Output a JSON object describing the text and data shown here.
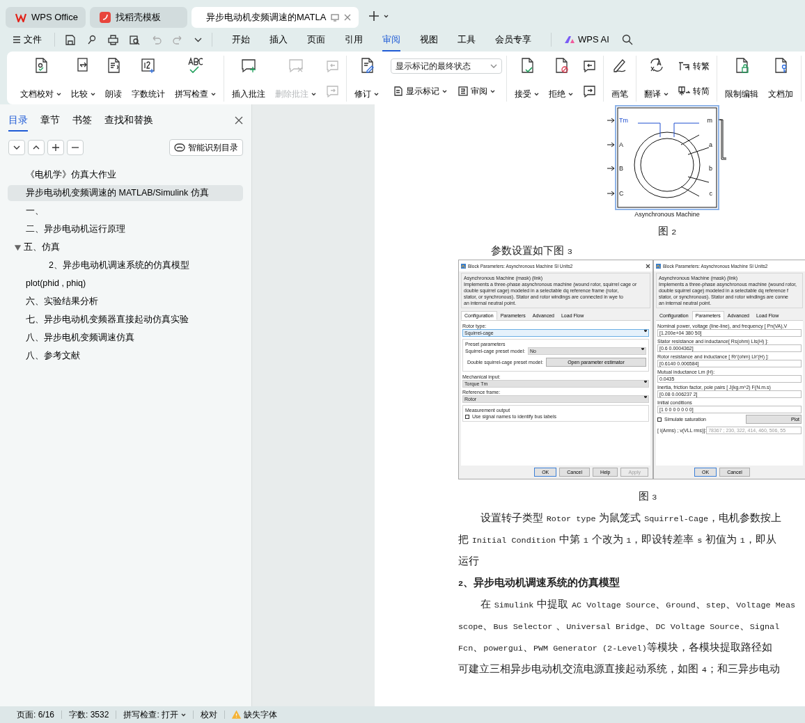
{
  "browser_tabs": [
    {
      "label": "WPS Office",
      "selected": false
    },
    {
      "label": "找稻壳模板",
      "selected": false
    },
    {
      "label": "异步电动机变频调速的MATLA",
      "selected": true
    }
  ],
  "file_menu": "文件",
  "menu_tabs": [
    {
      "label": "开始",
      "selected": false
    },
    {
      "label": "插入",
      "selected": false
    },
    {
      "label": "页面",
      "selected": false
    },
    {
      "label": "引用",
      "selected": false
    },
    {
      "label": "审阅",
      "selected": true
    },
    {
      "label": "视图",
      "selected": false
    },
    {
      "label": "工具",
      "selected": false
    },
    {
      "label": "会员专享",
      "selected": false
    }
  ],
  "ai_label": "WPS AI",
  "ribbon_groups": [
    [
      {
        "kind": "large",
        "label": "文档校对",
        "dropdown": true,
        "disabled": false
      },
      {
        "kind": "large",
        "label": "比较",
        "dropdown": true,
        "disabled": false
      },
      {
        "kind": "large",
        "label": "朗读",
        "dropdown": false,
        "disabled": false
      },
      {
        "kind": "large",
        "label": "字数统计",
        "dropdown": false,
        "disabled": false
      },
      {
        "kind": "large",
        "label": "拼写检查",
        "dropdown": true,
        "disabled": false
      }
    ],
    [
      {
        "kind": "large",
        "label": "插入批注",
        "dropdown": false,
        "disabled": false
      },
      {
        "kind": "large",
        "label": "删除批注",
        "dropdown": true,
        "disabled": true
      },
      {
        "kind": "icon_pair",
        "disabled": true
      }
    ],
    [
      {
        "kind": "large",
        "label": "修订",
        "dropdown": true,
        "disabled": false
      },
      {
        "kind": "markup_panel",
        "select": "显示标记的最终状态",
        "buttons": [
          {
            "label": "显示标记",
            "dropdown": true
          },
          {
            "label": "审阅",
            "dropdown": true
          }
        ]
      }
    ],
    [
      {
        "kind": "large",
        "label": "接受",
        "dropdown": true,
        "disabled": false
      },
      {
        "kind": "large",
        "label": "拒绝",
        "dropdown": true,
        "disabled": false
      },
      {
        "kind": "icon_pair",
        "disabled": false
      }
    ],
    [
      {
        "kind": "large",
        "label": "画笔",
        "dropdown": false,
        "disabled": false
      }
    ],
    [
      {
        "kind": "large",
        "label": "翻译",
        "dropdown": true,
        "disabled": false
      },
      {
        "kind": "small_stack",
        "buttons": [
          {
            "label": "转繁"
          },
          {
            "label": "转简"
          }
        ]
      }
    ],
    [
      {
        "kind": "large",
        "label": "限制编辑",
        "dropdown": false,
        "disabled": false
      },
      {
        "kind": "large",
        "label": "文档加",
        "dropdown": false,
        "disabled": false
      }
    ]
  ],
  "sidebar": {
    "tabs": [
      {
        "label": "目录",
        "selected": true
      },
      {
        "label": "章节",
        "selected": false
      },
      {
        "label": "书签",
        "selected": false
      },
      {
        "label": "查找和替换",
        "selected": false
      }
    ],
    "smart_button": "智能识别目录",
    "outline": [
      {
        "label": "《电机学》仿真大作业",
        "selected": false
      },
      {
        "label": "异步电动机变频调速的 MATLAB/Simulink 仿真",
        "selected": true
      },
      {
        "label": "一、",
        "selected": false
      },
      {
        "label": "二、异步电动机运行原理",
        "selected": false
      },
      {
        "label": "五、仿真",
        "selected": false,
        "expanded": true,
        "children": [
          {
            "label": "2、异步电动机调速系统的仿真模型",
            "selected": false
          }
        ]
      },
      {
        "label": "plot(phid , phiq)",
        "selected": false
      },
      {
        "label": "六、实验结果分析",
        "selected": false
      },
      {
        "label": "七、异步电动机变频器直接起动仿真实验",
        "selected": false
      },
      {
        "label": "八、异步电机变频调速仿真",
        "selected": false
      },
      {
        "label": "八、参考文献",
        "selected": false
      }
    ]
  },
  "document": {
    "figure2": {
      "ports_left": [
        "Tm",
        "A",
        "B",
        "C"
      ],
      "ports_right": [
        "m",
        "a",
        "b",
        "c"
      ],
      "block_name": "Asynchronous Machine",
      "caption": "图 2"
    },
    "intro": "参数设置如下图 3",
    "figure3": {
      "caption": "图 3",
      "dialogs": [
        {
          "title": "Block Parameters: Asynchronous Machine SI Units2",
          "closable": true,
          "mask": "Asynchronous Machine (mask) (link)",
          "description": [
            "Implements a three-phase asynchronous machine (wound rotor, squirrel cage or",
            "double squirrel cage) modeled in a selectable dq reference frame (rotor,",
            "stator, or synchronous). Stator and rotor windings are connected in wye to",
            "an internal neutral point."
          ],
          "tabs": [
            {
              "label": "Configuration",
              "selected": true
            },
            {
              "label": "Parameters",
              "selected": false
            },
            {
              "label": "Advanced",
              "selected": false
            },
            {
              "label": "Load Flow",
              "selected": false
            }
          ],
          "fields": [
            {
              "kind": "label",
              "text": "Rotor type:"
            },
            {
              "kind": "select",
              "value": "Squirrel-cage",
              "focused": true
            },
            {
              "kind": "group",
              "title": "Preset parameters",
              "items": [
                {
                  "kind": "inline_select",
                  "label": "Squirrel-cage preset model:",
                  "value": "No"
                },
                {
                  "kind": "inline_button",
                  "label": "Double squirrel-cage preset model:",
                  "button": "Open parameter estimator"
                }
              ]
            },
            {
              "kind": "label",
              "text": "Mechanical input:"
            },
            {
              "kind": "select",
              "value": "Torque Tm",
              "focused": false
            },
            {
              "kind": "label",
              "text": "Reference frame:"
            },
            {
              "kind": "select",
              "value": "Rotor",
              "focused": false
            },
            {
              "kind": "group",
              "title": "Measurement output",
              "items": [
                {
                  "kind": "checkbox",
                  "label": "Use signal names to identify bus labels",
                  "checked": false
                }
              ]
            }
          ],
          "buttons": [
            {
              "label": "OK",
              "disabled": false
            },
            {
              "label": "Cancel",
              "disabled": false
            },
            {
              "label": "Help",
              "disabled": false
            },
            {
              "label": "Apply",
              "disabled": true
            }
          ]
        },
        {
          "title": "Block Parameters: Asynchronous Machine SI Units2",
          "closable": false,
          "mask": "Asynchronous Machine (mask) (link)",
          "description": [
            "Implements a three-phase asynchronous machine (wound rotor,",
            "double squirrel cage) modeled in a selectable dq reference f",
            "stator, or synchronous). Stator and rotor windings are conne",
            "an internal neutral point."
          ],
          "tabs": [
            {
              "label": "Configuration",
              "selected": false
            },
            {
              "label": "Parameters",
              "selected": true
            },
            {
              "label": "Advanced",
              "selected": false
            },
            {
              "label": "Load Flow",
              "selected": false
            }
          ],
          "fields": [
            {
              "kind": "label",
              "text": "Nominal power, voltage (line-line), and frequency [ Pn(VA),V"
            },
            {
              "kind": "field",
              "value": "[1.200e+04 380 50]"
            },
            {
              "kind": "label",
              "text": "Stator resistance and inductance[ Rs(ohm)  Lls(H) ]:"
            },
            {
              "kind": "field",
              "value": "[0.6 0.0004362]"
            },
            {
              "kind": "label",
              "text": "Rotor resistance and inductance [ Rr'(ohm)  Llr'(H) ]:"
            },
            {
              "kind": "field",
              "value": "[0.6140 0.006584]"
            },
            {
              "kind": "label",
              "text": "Mutual inductance Lm (H):"
            },
            {
              "kind": "field",
              "value": "0.0435"
            },
            {
              "kind": "label",
              "text": "Inertia, friction factor, pole pairs [ J(kg.m^2)  F(N.m.s)"
            },
            {
              "kind": "field",
              "value": "[0.08 0.006237 2]"
            },
            {
              "kind": "label",
              "text": "Initial conditions"
            },
            {
              "kind": "field",
              "value": "[1 0 0 0 0 0 0 0]"
            },
            {
              "kind": "checkbox_button",
              "label": "Simulate saturation",
              "checked": false,
              "button": "Plot"
            },
            {
              "kind": "inline_field",
              "label": "[ i(Arms) ; v(VLL rms)]:",
              "value": "78367 ; 230, 322, 414, 460, 506, 55",
              "disabled": true
            }
          ],
          "buttons": [
            {
              "label": "OK",
              "disabled": false
            },
            {
              "label": "Cancel",
              "disabled": false
            }
          ]
        }
      ]
    },
    "paragraphs": [
      {
        "kind": "body",
        "lines": [
          "设置转子类型 Rotor type 为鼠笼式 Squirrel-Cage，电机参数按上",
          "把 Initial Condition 中第 1 个改为 1，即设转差率 s 初值为 1，即从",
          "运行"
        ]
      },
      {
        "kind": "heading",
        "lines": [
          "2、异步电动机调速系统的仿真模型"
        ]
      },
      {
        "kind": "body",
        "lines": [
          "在 Simulink 中提取 AC Voltage Source、Ground、step、Voltage Meas",
          "scope、Bus Selector 、Universal Bridge、DC Voltage Source、Signal",
          "Fcn、powergui、PWM Generator (2-Level)等模块，各模块提取路径如",
          "可建立三相异步电动机交流电源直接起动系统，如图 4；和三异步电动"
        ]
      }
    ]
  },
  "status_bar": [
    {
      "kind": "text",
      "label": "页面: 6/16",
      "dropdown": false
    },
    {
      "kind": "text",
      "label": "字数: 3532",
      "dropdown": false
    },
    {
      "kind": "text",
      "label": "拼写检查: 打开",
      "dropdown": true
    },
    {
      "kind": "text",
      "label": "校对",
      "dropdown": false
    },
    {
      "kind": "warning",
      "label": "缺失字体",
      "dropdown": false
    }
  ]
}
